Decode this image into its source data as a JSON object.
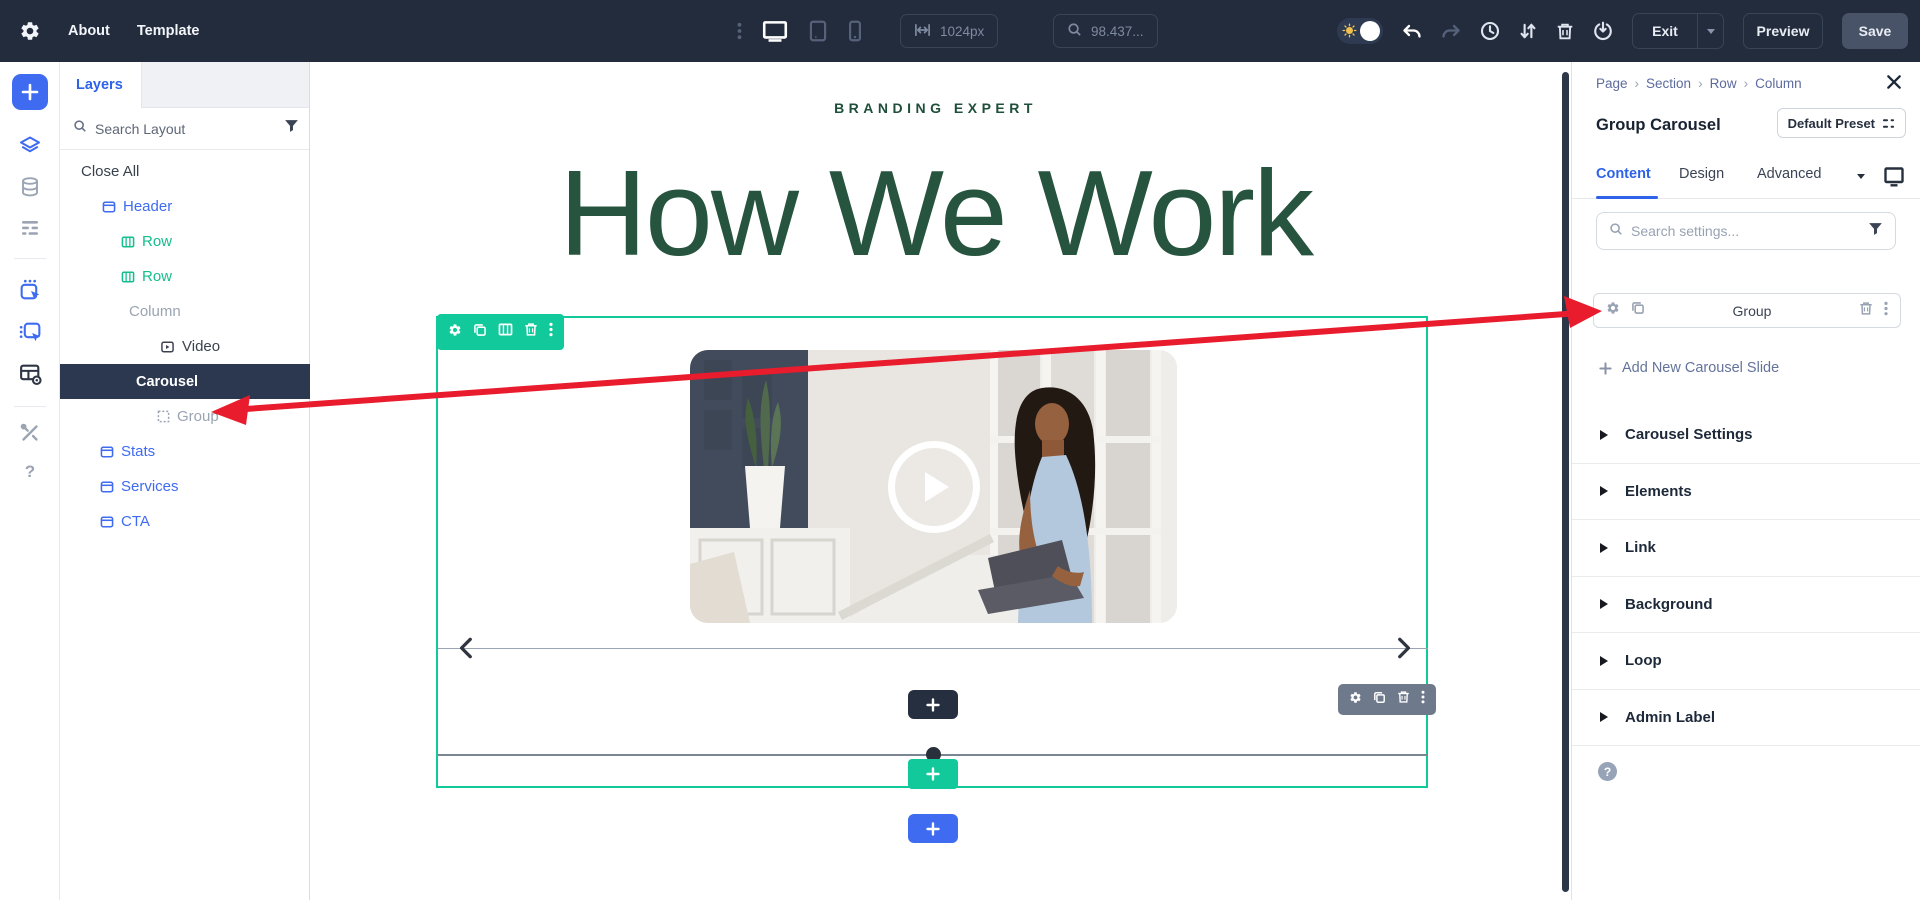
{
  "toolbar": {
    "menu_about": "About",
    "menu_template": "Template",
    "width_value": "1024px",
    "zoom_value": "98.437...",
    "exit_label": "Exit",
    "preview_label": "Preview",
    "save_label": "Save"
  },
  "layers": {
    "tab_label": "Layers",
    "search_placeholder": "Search Layout",
    "close_all_label": "Close All",
    "tree": [
      {
        "label": "Header"
      },
      {
        "label": "Row"
      },
      {
        "label": "Row"
      },
      {
        "label": "Column"
      },
      {
        "label": "Video"
      },
      {
        "label": "Carousel"
      },
      {
        "label": "Group"
      },
      {
        "label": "Stats"
      },
      {
        "label": "Services"
      },
      {
        "label": "CTA"
      }
    ]
  },
  "canvas": {
    "eyebrow": "BRANDING EXPERT",
    "heading": "How We Work"
  },
  "inspector": {
    "breadcrumb": [
      {
        "label": "Page"
      },
      {
        "label": "Section"
      },
      {
        "label": "Row"
      },
      {
        "label": "Column"
      }
    ],
    "title": "Group Carousel",
    "preset_label": "Default Preset",
    "tab_content": "Content",
    "tab_design": "Design",
    "tab_advanced": "Advanced",
    "search_placeholder": "Search settings...",
    "group_row_label": "Group",
    "add_slide_label": "Add New Carousel Slide",
    "sections": [
      {
        "label": "Carousel Settings"
      },
      {
        "label": "Elements"
      },
      {
        "label": "Link"
      },
      {
        "label": "Background"
      },
      {
        "label": "Loop"
      },
      {
        "label": "Admin Label"
      }
    ]
  },
  "colors": {
    "accent_blue": "#3E6BF0",
    "selection_teal": "#12C99B",
    "heading_green": "#27543E",
    "toolbar_bg": "#232C3D",
    "annotation_red": "#E81C2C"
  }
}
